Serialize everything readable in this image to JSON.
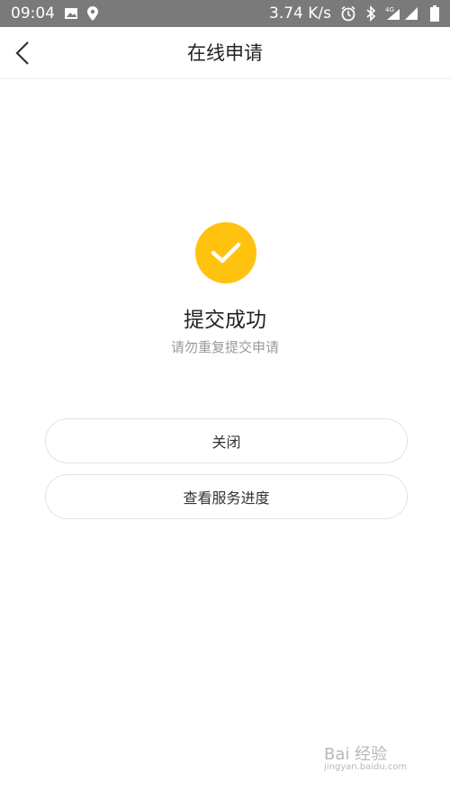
{
  "status_bar": {
    "time": "09:04",
    "speed": "3.74 K/s",
    "network": "4G"
  },
  "nav": {
    "title": "在线申请"
  },
  "result": {
    "title": "提交成功",
    "subtitle": "请勿重复提交申请",
    "accent_color": "#FFC20E"
  },
  "buttons": {
    "close_label": "关闭",
    "progress_label": "查看服务进度"
  },
  "watermark": {
    "text": "Bai 经验",
    "url": "jingyan.baidu.com"
  },
  "icons": [
    "image-icon",
    "location-icon",
    "alarm-icon",
    "bluetooth-icon",
    "signal-icon",
    "battery-icon",
    "back-chevron-icon",
    "check-icon"
  ]
}
